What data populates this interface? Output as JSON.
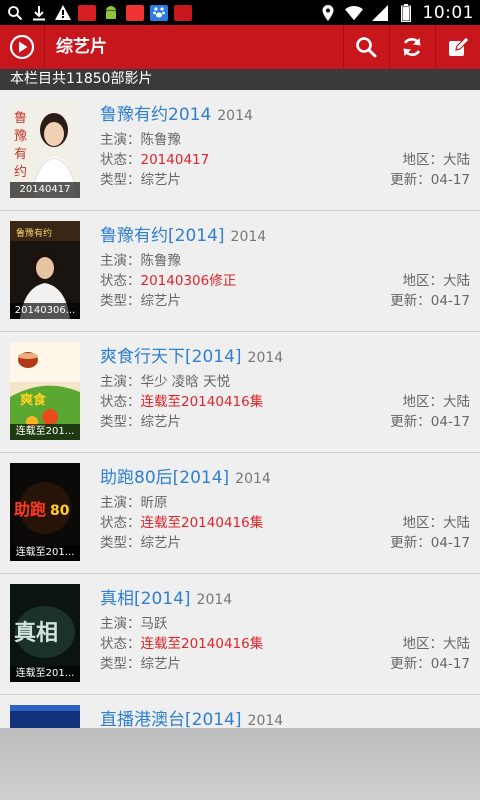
{
  "status_bar": {
    "time": "10:01",
    "left_icons": [
      "search-icon",
      "download-icon",
      "warning-icon",
      "app-icon",
      "android-icon",
      "app-icon",
      "paw-icon",
      "app-icon"
    ],
    "right_icons": [
      "location-icon",
      "wifi-icon",
      "signal-icon",
      "battery-icon"
    ]
  },
  "toolbar": {
    "title": "综艺片",
    "accent": "#c8161d"
  },
  "count_bar": {
    "text": "本栏目共11850部影片"
  },
  "items": [
    {
      "title": "鲁豫有约2014",
      "year": "2014",
      "star_label": "主演：",
      "star": "陈鲁豫",
      "status_label": "状态：",
      "status": "20140417",
      "type_label": "类型：",
      "type": "综艺片",
      "region_label": "地区：",
      "region": "大陆",
      "update_label": "更新：",
      "update": "04-17",
      "thumb_caption": "20140417"
    },
    {
      "title": "鲁豫有约[2014]",
      "year": "2014",
      "star_label": "主演：",
      "star": "陈鲁豫",
      "status_label": "状态：",
      "status": "20140306修正",
      "type_label": "类型：",
      "type": "综艺片",
      "region_label": "地区：",
      "region": "大陆",
      "update_label": "更新：",
      "update": "04-17",
      "thumb_caption": "20140306..."
    },
    {
      "title": "爽食行天下[2014]",
      "year": "2014",
      "star_label": "主演：",
      "star": "华少 凌晗 天悦",
      "status_label": "状态：",
      "status": "连载至20140416集",
      "type_label": "类型：",
      "type": "综艺片",
      "region_label": "地区：",
      "region": "大陆",
      "update_label": "更新：",
      "update": "04-17",
      "thumb_caption": "连载至201..."
    },
    {
      "title": "助跑80后[2014]",
      "year": "2014",
      "star_label": "主演：",
      "star": "昕原",
      "status_label": "状态：",
      "status": "连载至20140416集",
      "type_label": "类型：",
      "type": "综艺片",
      "region_label": "地区：",
      "region": "大陆",
      "update_label": "更新：",
      "update": "04-17",
      "thumb_caption": "连载至201..."
    },
    {
      "title": "真相[2014]",
      "year": "2014",
      "star_label": "主演：",
      "star": "马跃",
      "status_label": "状态：",
      "status": "连载至20140416集",
      "type_label": "类型：",
      "type": "综艺片",
      "region_label": "地区：",
      "region": "大陆",
      "update_label": "更新：",
      "update": "04-17",
      "thumb_caption": "连载至201..."
    },
    {
      "title": "直播港澳台[2014]",
      "year": "2014"
    }
  ],
  "colors": {
    "title_blue": "#2f80d1",
    "status_red": "#e0242a",
    "meta_gray": "#666666"
  }
}
